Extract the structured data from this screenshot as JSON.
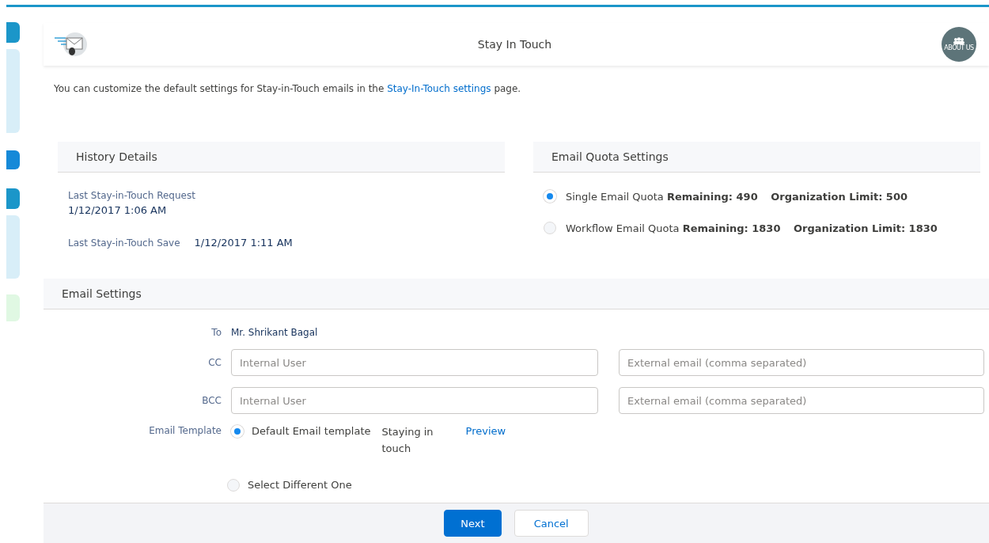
{
  "header": {
    "title": "Stay In Touch",
    "badge": "ABOUT US"
  },
  "intro": {
    "text": "You can customize the default settings for Stay-in-Touch emails in the ",
    "link": "Stay-In-Touch settings",
    "after": " page."
  },
  "history": {
    "title": "History Details",
    "request_label": "Last Stay-in-Touch Request",
    "request_value": "1/12/2017 1:06 AM",
    "save_label": "Last Stay-in-Touch Save",
    "save_value": "1/12/2017 1:11 AM"
  },
  "quota": {
    "title": "Email Quota Settings",
    "options": [
      {
        "label": "Single Email Quota",
        "remaining": "Remaining: 490",
        "limit": "Organization Limit: 500",
        "selected": true
      },
      {
        "label": "Workflow Email Quota",
        "remaining": "Remaining: 1830",
        "limit": "Organization Limit: 1830",
        "selected": false
      }
    ]
  },
  "email_settings": {
    "title": "Email Settings",
    "to_label": "To",
    "to_value": "Mr. Shrikant Bagal",
    "rows": [
      {
        "label": "CC",
        "internal_placeholder": "Internal User",
        "external_placeholder": "External email (comma separated)"
      },
      {
        "label": "BCC",
        "internal_placeholder": "Internal User",
        "external_placeholder": "External email (comma separated)"
      }
    ],
    "template_label": "Email Template",
    "templates": [
      {
        "label": "Default Email template",
        "name": "Staying in touch",
        "preview": "Preview",
        "selected": true
      },
      {
        "label": "Select Different One",
        "selected": false
      }
    ]
  },
  "footer": {
    "buttons": [
      {
        "label": "Next",
        "kind": "primary"
      },
      {
        "label": "Cancel",
        "kind": "neutral"
      }
    ]
  }
}
